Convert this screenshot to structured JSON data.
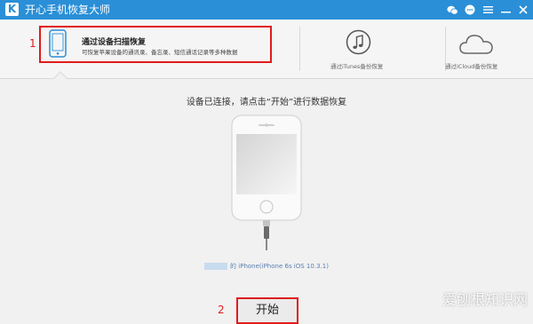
{
  "app": {
    "logo_letter": "K",
    "title": "开心手机恢复大师"
  },
  "titlebar_icons": [
    "wechat-icon",
    "message-icon",
    "menu-icon",
    "minimize-icon",
    "close-icon"
  ],
  "tabs": [
    {
      "title": "通过设备扫描恢复",
      "subtitle": "可恢复苹果设备的通讯录、备忘录、短信通话记录等多种数据"
    },
    {
      "caption": "通过iTunes备份恢复"
    },
    {
      "caption": "通过iCloud备份恢复"
    }
  ],
  "annotations": {
    "step1": "1",
    "step2": "2"
  },
  "main": {
    "prompt": "设备已连接，请点击“开始”进行数据恢复",
    "device_info": "的 iPhone(iPhone 6s iOS 10.3.1)",
    "start_label": "开始"
  },
  "watermark": "爱刨根知识网",
  "colors": {
    "titlebar": "#2a8fd7",
    "highlight": "#e01c1c",
    "background": "#f1f1f1"
  }
}
